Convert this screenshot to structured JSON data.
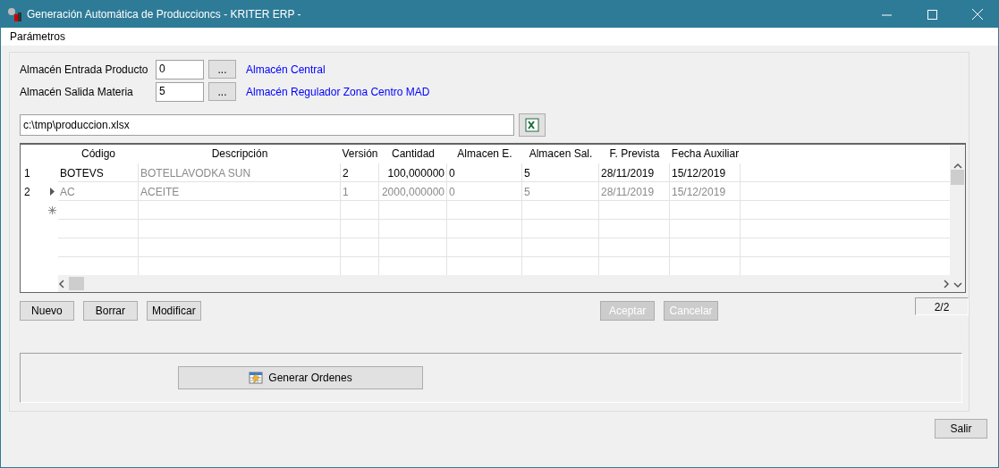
{
  "window": {
    "title": "Generación Automática de Produccioncs - KRITER ERP -"
  },
  "menu": [
    "Parámetros"
  ],
  "fields": [
    {
      "label": "Almacén Entrada Producto",
      "value": "0",
      "button": "...",
      "description": "Almacén Central"
    },
    {
      "label": "Almacén Salida Materia",
      "value": "5",
      "button": "...",
      "description": "Almacén Regulador Zona Centro MAD"
    }
  ],
  "file": {
    "value": "c:\\tmp\\produccion.xlsx"
  },
  "table": {
    "columns": [
      {
        "label": "Código",
        "kind": "text",
        "muted": false
      },
      {
        "label": "Descripción",
        "kind": "text",
        "muted": true
      },
      {
        "label": "Versión",
        "kind": "text",
        "muted": false
      },
      {
        "label": "Cantidad",
        "kind": "number",
        "muted": false
      },
      {
        "label": "Almacen E.",
        "kind": "text",
        "muted": false
      },
      {
        "label": "Almacen Sal.",
        "kind": "text",
        "muted": false
      },
      {
        "label": "F. Prevista",
        "kind": "text",
        "muted": false
      },
      {
        "label": "Fecha Auxiliar",
        "kind": "text",
        "muted": false
      }
    ],
    "rows": [
      {
        "number": "1",
        "selected": false,
        "cells": [
          "BOTEVS",
          "BOTELLAVODKA SUN",
          "2",
          "100,000000",
          "0",
          "5",
          "28/11/2019",
          "15/12/2019"
        ]
      },
      {
        "number": "2",
        "selected": true,
        "cells": [
          "AC",
          "ACEITE",
          "1",
          "2000,000000",
          "0",
          "5",
          "28/11/2019",
          "15/12/2019"
        ]
      }
    ]
  },
  "actions": [
    {
      "label": "Nuevo",
      "disabled": false
    },
    {
      "label": "Borrar",
      "disabled": false
    },
    {
      "label": "Modificar",
      "disabled": false
    }
  ],
  "confirm": [
    {
      "label": "Aceptar",
      "disabled": true
    },
    {
      "label": "Cancelar",
      "disabled": true
    }
  ],
  "counter": "2/2",
  "generate_button": "Generar Ordenes",
  "exit_button": "Salir"
}
